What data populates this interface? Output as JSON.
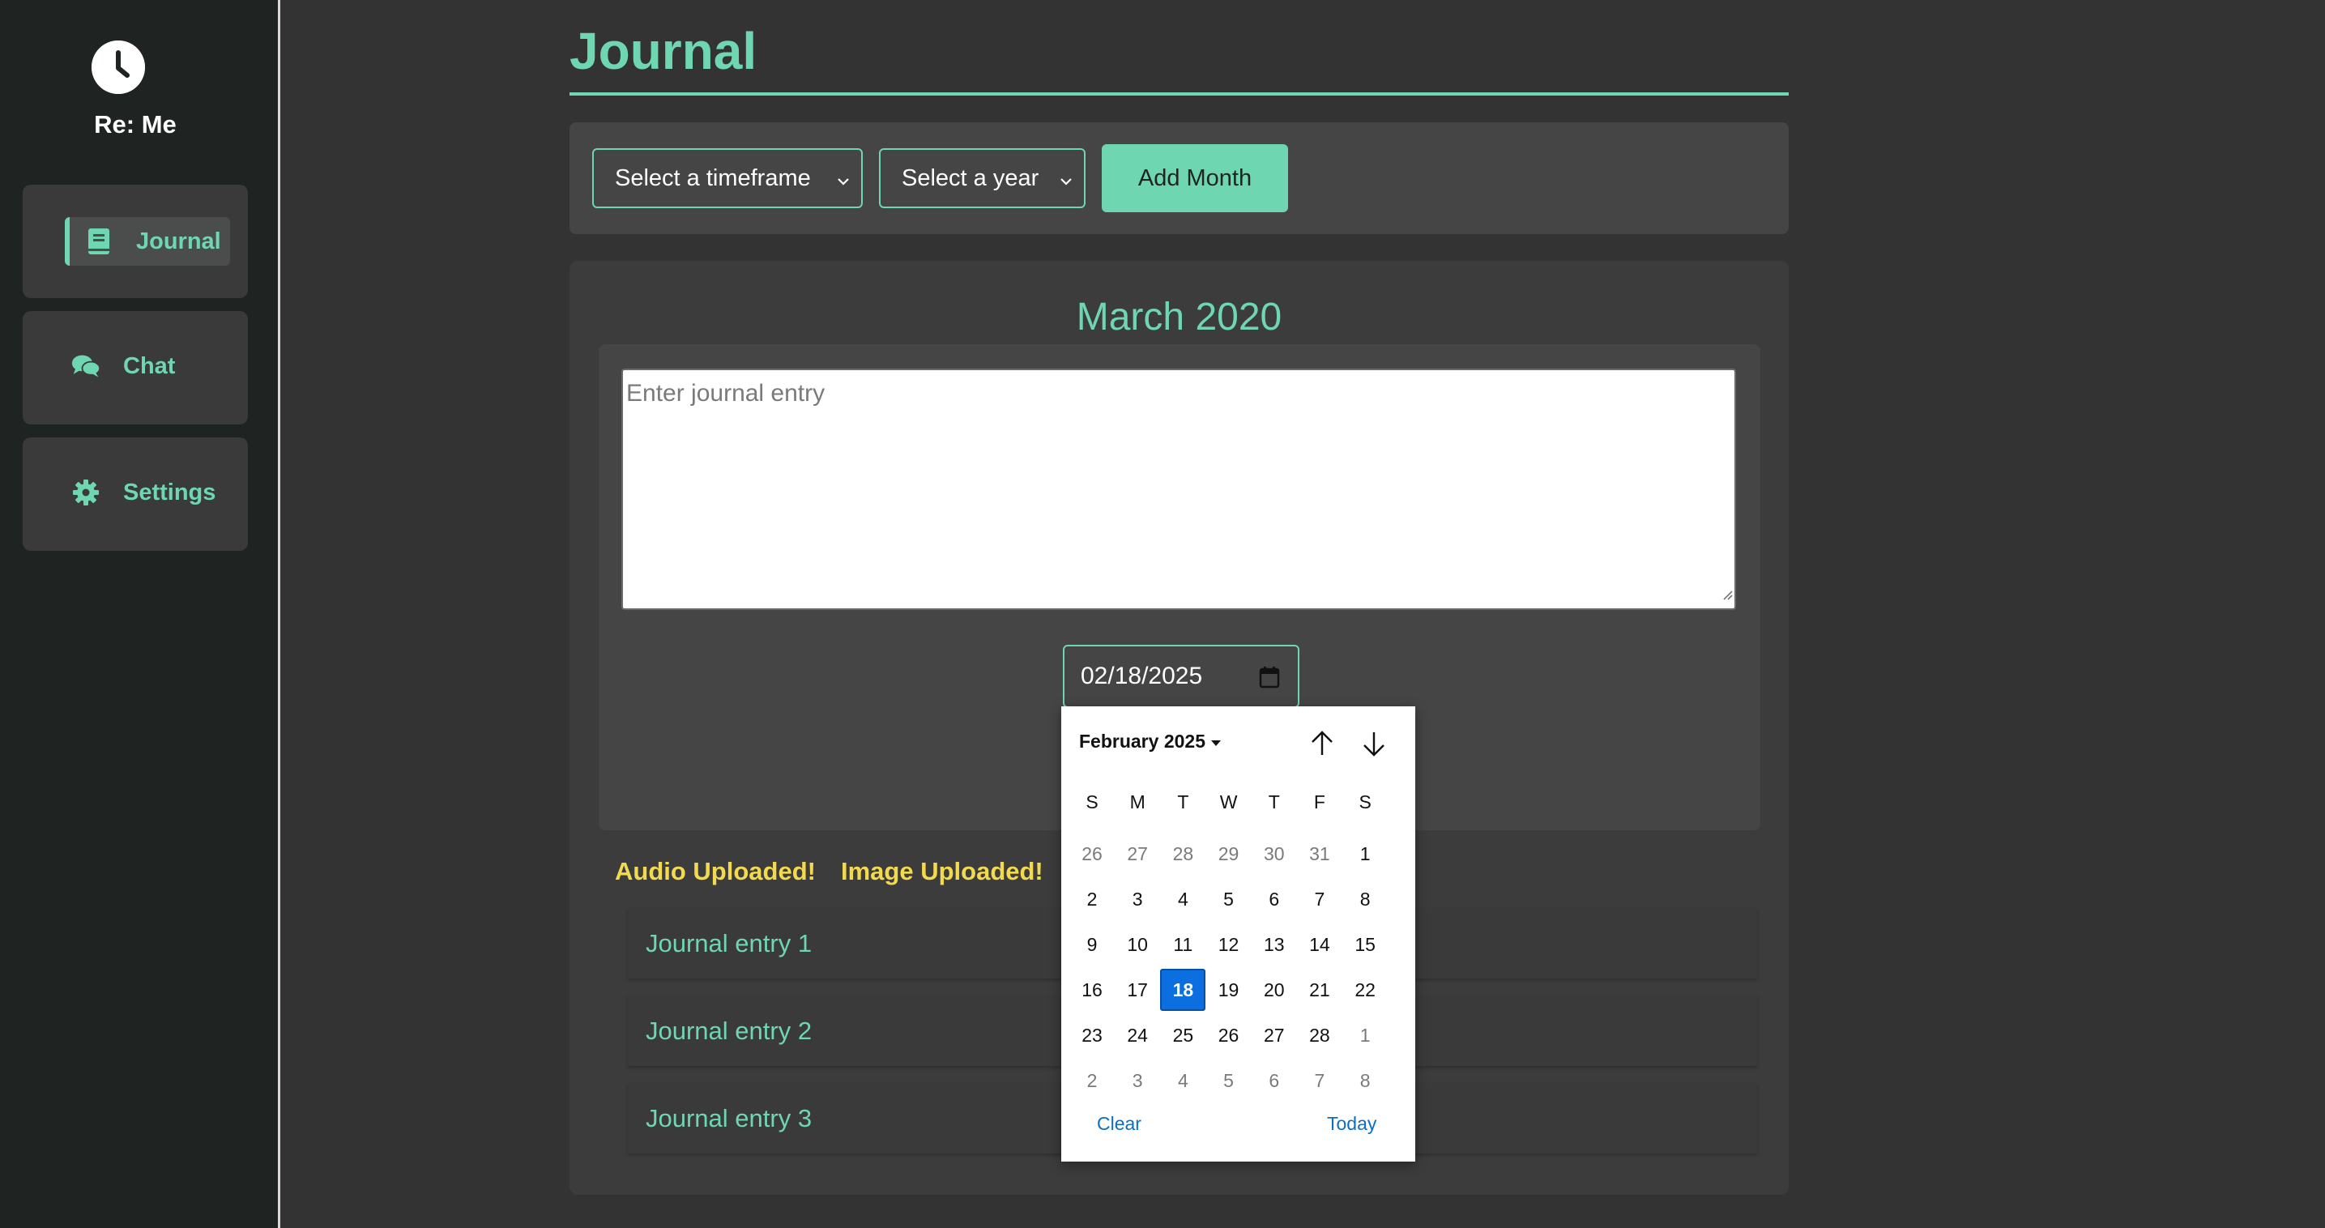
{
  "app": {
    "name": "Re: Me"
  },
  "sidebar": {
    "items": [
      {
        "label": "Journal",
        "icon": "book-icon",
        "active": true
      },
      {
        "label": "Chat",
        "icon": "chat-bubbles-icon",
        "active": false
      },
      {
        "label": "Settings",
        "icon": "gear-icon",
        "active": false
      }
    ]
  },
  "header": {
    "title": "Journal"
  },
  "toolbar": {
    "timeframe_select": "Select a timeframe",
    "year_select": "Select a year",
    "add_month_label": "Add Month"
  },
  "month_card": {
    "title": "March 2020",
    "entry_placeholder": "Enter journal entry",
    "date_value": "02/18/2025",
    "audio_status": "Audio Uploaded!",
    "image_status": "Image Uploaded!",
    "entries": [
      "Journal entry 1",
      "Journal entry 2",
      "Journal entry 3"
    ]
  },
  "datepicker": {
    "month_label": "February 2025",
    "weekdays": [
      "S",
      "M",
      "T",
      "W",
      "T",
      "F",
      "S"
    ],
    "weeks": [
      [
        {
          "d": "26",
          "m": true
        },
        {
          "d": "27",
          "m": true
        },
        {
          "d": "28",
          "m": true
        },
        {
          "d": "29",
          "m": true
        },
        {
          "d": "30",
          "m": true
        },
        {
          "d": "31",
          "m": true
        },
        {
          "d": "1",
          "m": false
        }
      ],
      [
        {
          "d": "2",
          "m": false
        },
        {
          "d": "3",
          "m": false
        },
        {
          "d": "4",
          "m": false
        },
        {
          "d": "5",
          "m": false
        },
        {
          "d": "6",
          "m": false
        },
        {
          "d": "7",
          "m": false
        },
        {
          "d": "8",
          "m": false
        }
      ],
      [
        {
          "d": "9",
          "m": false
        },
        {
          "d": "10",
          "m": false
        },
        {
          "d": "11",
          "m": false
        },
        {
          "d": "12",
          "m": false
        },
        {
          "d": "13",
          "m": false
        },
        {
          "d": "14",
          "m": false
        },
        {
          "d": "15",
          "m": false
        }
      ],
      [
        {
          "d": "16",
          "m": false
        },
        {
          "d": "17",
          "m": false
        },
        {
          "d": "18",
          "m": false,
          "sel": true
        },
        {
          "d": "19",
          "m": false
        },
        {
          "d": "20",
          "m": false
        },
        {
          "d": "21",
          "m": false
        },
        {
          "d": "22",
          "m": false
        }
      ],
      [
        {
          "d": "23",
          "m": false
        },
        {
          "d": "24",
          "m": false
        },
        {
          "d": "25",
          "m": false
        },
        {
          "d": "26",
          "m": false
        },
        {
          "d": "27",
          "m": false
        },
        {
          "d": "28",
          "m": false
        },
        {
          "d": "1",
          "m": true
        }
      ],
      [
        {
          "d": "2",
          "m": true
        },
        {
          "d": "3",
          "m": true
        },
        {
          "d": "4",
          "m": true
        },
        {
          "d": "5",
          "m": true
        },
        {
          "d": "6",
          "m": true
        },
        {
          "d": "7",
          "m": true
        },
        {
          "d": "8",
          "m": true
        }
      ]
    ],
    "clear_label": "Clear",
    "today_label": "Today"
  },
  "colors": {
    "accent": "#6fd6b2",
    "status_yellow": "#f2d94e",
    "sidebar_bg": "#1f2423",
    "main_bg": "#333333",
    "selected_day": "#0b6fe0"
  }
}
